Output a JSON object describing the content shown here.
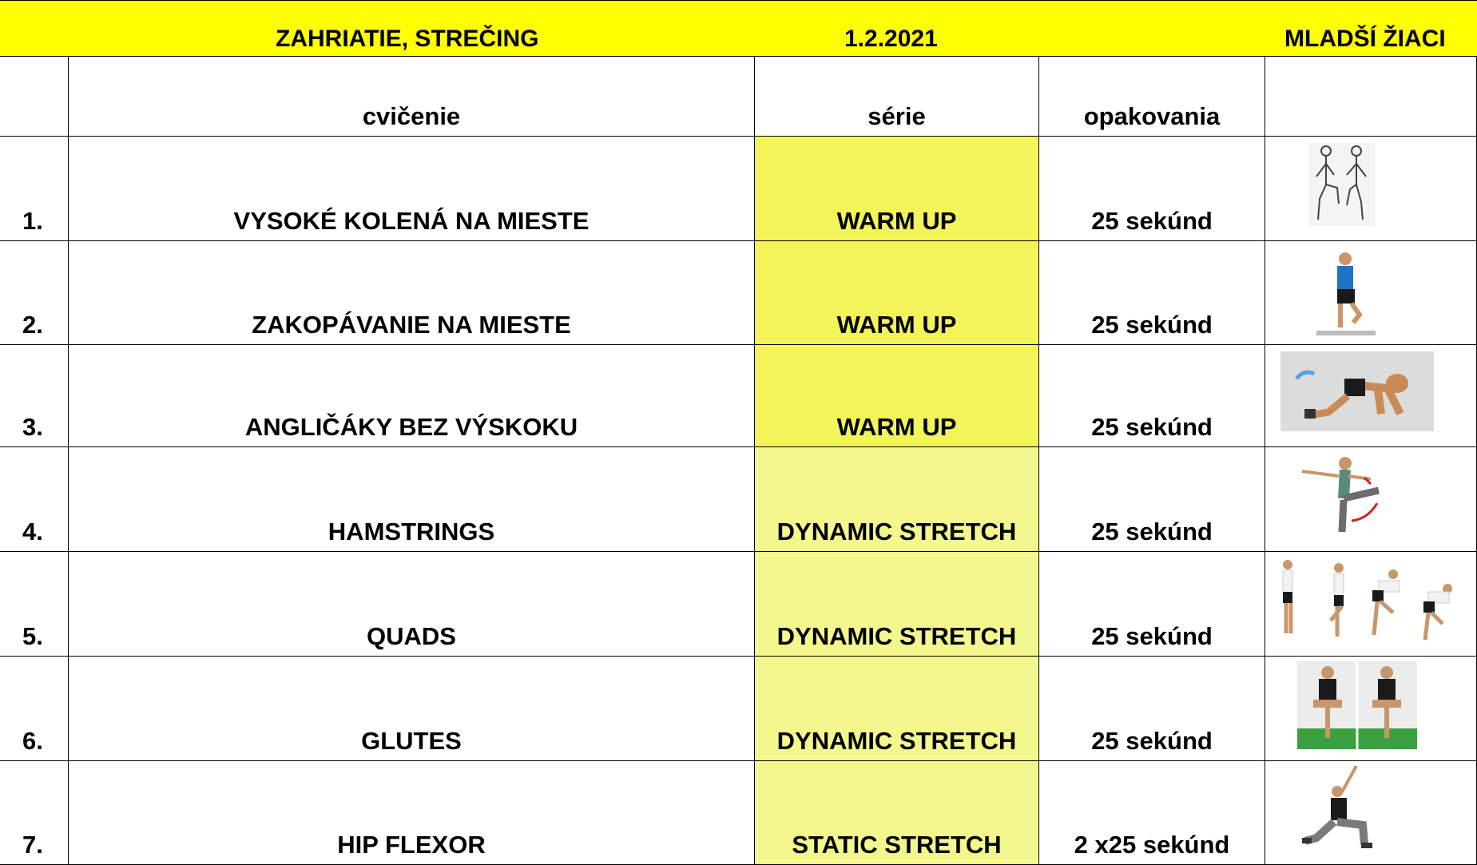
{
  "header": {
    "title": "ZAHRIATIE, STREČING",
    "date": "1.2.2021",
    "group": "MLADŠÍ ŽIACI"
  },
  "columns": {
    "exercise": "cvičenie",
    "series": "série",
    "reps": "opakovania"
  },
  "rows": [
    {
      "num": "1.",
      "exercise": "VYSOKÉ KOLENÁ NA MIESTE",
      "series": "WARM UP",
      "reps": "25 sekúnd",
      "image": "high-knees-illustration"
    },
    {
      "num": "2.",
      "exercise": "ZAKOPÁVANIE NA MIESTE",
      "series": "WARM UP",
      "reps": "25 sekúnd",
      "image": "butt-kicks-photo"
    },
    {
      "num": "3.",
      "exercise": "ANGLIČÁKY BEZ VÝSKOKU",
      "series": "WARM UP",
      "reps": "25 sekúnd",
      "image": "burpee-illustration"
    },
    {
      "num": "4.",
      "exercise": "HAMSTRINGS",
      "series": "DYNAMIC STRETCH",
      "reps": "25 sekúnd",
      "image": "leg-swing-photo"
    },
    {
      "num": "5.",
      "exercise": "QUADS",
      "series": "DYNAMIC STRETCH",
      "reps": "25 sekúnd",
      "image": "quad-stretch-sequence"
    },
    {
      "num": "6.",
      "exercise": "GLUTES",
      "series": "DYNAMIC STRETCH",
      "reps": "25 sekúnd",
      "image": "glute-stretch-photo"
    },
    {
      "num": "7.",
      "exercise": "HIP FLEXOR",
      "series": "STATIC STRETCH",
      "reps": "2 x25 sekúnd",
      "image": "hip-flexor-lunge-photo"
    }
  ],
  "colors": {
    "header": "#ffff00",
    "warm_up": "#f3f35a",
    "stretch": "#f3f78e"
  }
}
